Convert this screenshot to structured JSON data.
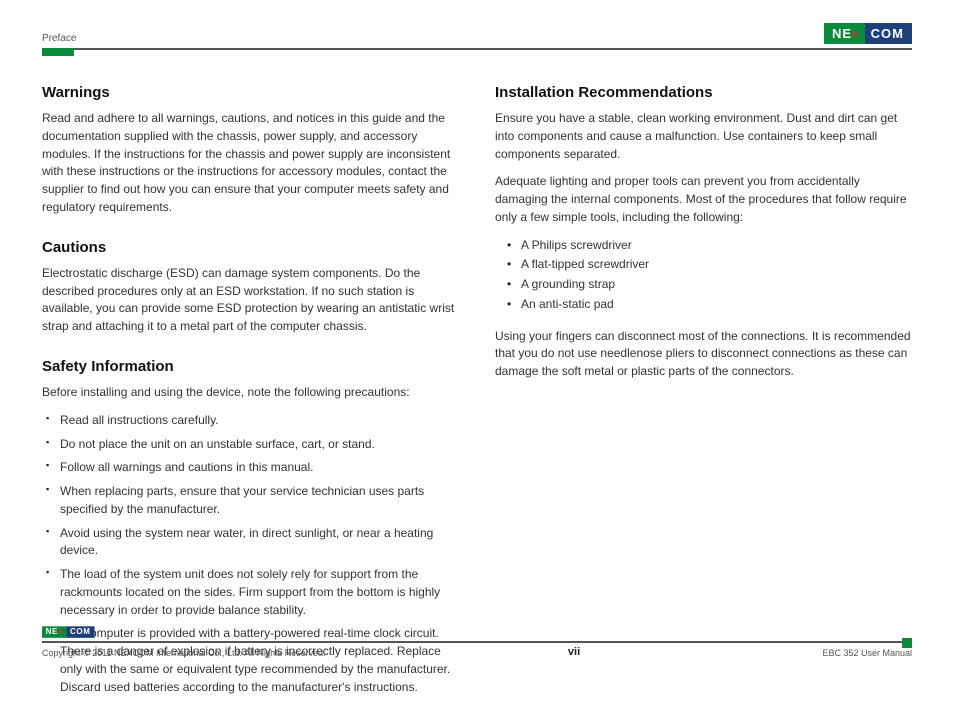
{
  "header": {
    "section": "Preface",
    "brand_left": "NE",
    "brand_right": "COM"
  },
  "left": {
    "warnings": {
      "title": "Warnings",
      "body": "Read and adhere to all warnings, cautions, and notices in this guide and the documentation supplied with the chassis, power supply, and accessory modules. If the instructions for the chassis and power supply are inconsistent  with these instructions or the instructions for accessory modules, contact the supplier to find out how you can ensure that your computer meets safety and regulatory requirements."
    },
    "cautions": {
      "title": "Cautions",
      "body": "Electrostatic discharge (ESD) can damage system components. Do the described procedures only at an ESD workstation. If no such station is available, you can provide some ESD protection by wearing an antistatic wrist strap and attaching it to a metal part of the computer chassis."
    },
    "safety": {
      "title": "Safety Information",
      "intro": "Before installing and using the device, note the following precautions:",
      "items": [
        "Read all instructions carefully.",
        "Do not place the unit on an unstable surface, cart, or stand.",
        "Follow all warnings and cautions in this manual.",
        "When replacing parts, ensure that your service technician uses parts specified by the manufacturer.",
        "Avoid using the system near water, in direct sunlight, or near a heating device.",
        "The load of the system unit does not solely rely for support from the rackmounts located on the sides. Firm support from the bottom is highly necessary in order to provide balance stability.",
        "The computer is provided with a battery-powered real-time clock circuit. There is a danger of explosion if battery is incorrectly replaced. Replace only with the same or equivalent type recommended by the manufacturer. Discard used batteries according to the manufacturer's instructions."
      ]
    }
  },
  "right": {
    "install": {
      "title": "Installation Recommendations",
      "p1": "Ensure you have a stable, clean working environment. Dust and dirt can get into components and cause a malfunction. Use containers to keep small components separated.",
      "p2": "Adequate lighting and proper tools can prevent you from accidentally damaging the internal components. Most of the procedures that follow require only a few simple tools, including the following:",
      "tools": [
        "A Philips screwdriver",
        "A flat-tipped screwdriver",
        "A grounding strap",
        "An anti-static pad"
      ],
      "p3": "Using your fingers can disconnect most of the connections. It is recommended that you do not use needlenose pliers to disconnect connections as these can damage the soft metal or plastic parts of the connectors."
    }
  },
  "footer": {
    "copyright": "Copyright © 2011 NEXCOM International Co., Ltd. All Rights Reserved.",
    "page": "vii",
    "doc": "EBC 352 User Manual"
  }
}
